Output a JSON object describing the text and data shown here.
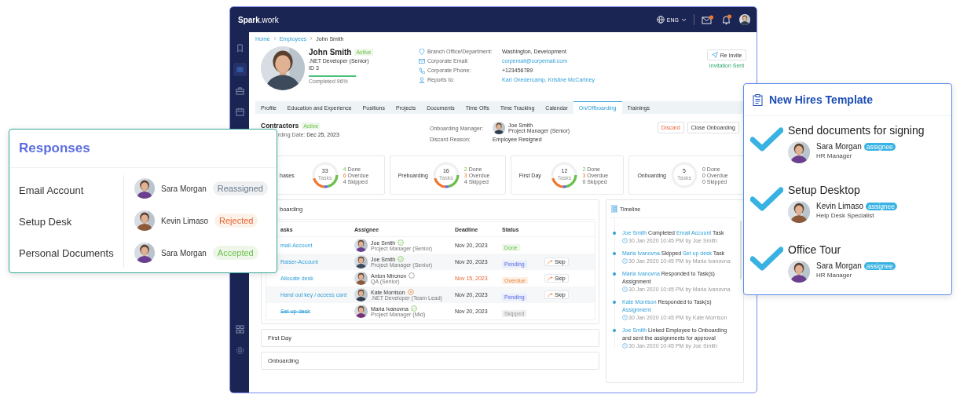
{
  "app": {
    "logo": "**Spark**.work",
    "language": "ENG",
    "sidebar": [
      {
        "kind": "bookmark",
        "selected": false
      },
      {
        "kind": "people",
        "selected": true
      },
      {
        "kind": "briefcase",
        "selected": false
      },
      {
        "kind": "calendar",
        "selected": false
      },
      {
        "kind": "grid",
        "selected": false
      },
      {
        "kind": "gear",
        "selected": false
      }
    ],
    "breadcrumb": [
      {
        "label": "Home",
        "link": true
      },
      {
        "label": "Employees",
        "link": true
      },
      {
        "label": "John Smith",
        "link": false
      }
    ],
    "profile": {
      "name": "John Smith",
      "status": "Active",
      "role": ".NET Developer (Senior)",
      "id": "ID 3",
      "level": 0.96,
      "completion": "Completed 96%",
      "details": [
        {
          "kind": "location",
          "label": "Branch Office/Department:",
          "value": "Washington, Development",
          "link": false
        },
        {
          "kind": "email",
          "label": "Corporate Email:",
          "value": "corpemail@corpemail.com",
          "link": true
        },
        {
          "kind": "phone",
          "label": "Corporate Phone:",
          "value": "+123456789",
          "link": false
        },
        {
          "kind": "person",
          "label": "Reports to:",
          "value": "Karl Onedercamp, Kristine McCartney",
          "link": true
        }
      ],
      "reinvite_button": "Re Invite",
      "invitation_status": "Invitation Sent"
    },
    "tabs": [
      {
        "label": "Profile",
        "selected": false
      },
      {
        "label": "Education and Experience",
        "selected": false
      },
      {
        "label": "Positions",
        "selected": false
      },
      {
        "label": "Projects",
        "selected": false
      },
      {
        "label": "Documents",
        "selected": false
      },
      {
        "label": "Time Offs",
        "selected": false
      },
      {
        "label": "Time Tracking",
        "selected": false
      },
      {
        "label": "Calendar",
        "selected": false
      },
      {
        "label": "On/Offboarding",
        "selected": true
      },
      {
        "label": "Trainings",
        "selected": false
      }
    ],
    "onboarding": {
      "title": "Contractors",
      "status": "Active",
      "date_label": "rding Date:",
      "date": "Dec 25, 2023",
      "manager_label": "Onboarding Manager:",
      "manager_name": "Joe Smith",
      "manager_role": "Project Manager (Senior)",
      "discard_label": "Discard Reason:",
      "discard_reason": "Employee Resigned",
      "discard_button": "Discard",
      "close_button": "Close Onboarding"
    },
    "phases": [
      {
        "name": "hases",
        "kind": "progress",
        "total": "33",
        "unit": "Tasks",
        "done": "4",
        "done_label": "Done",
        "overdue": "6",
        "overdue_label": "Overdue",
        "skipped": "4",
        "skipped_label": "Skipped"
      },
      {
        "name": "Preboarding",
        "kind": "progress",
        "total": "16",
        "unit": "Tasks",
        "done": "2",
        "done_label": "Done",
        "overdue": "3",
        "overdue_label": "Overdue",
        "skipped": "4",
        "skipped_label": "Skipped"
      },
      {
        "name": "First Day",
        "kind": "progress",
        "total": "12",
        "unit": "Tasks",
        "done": "2",
        "done_label": "Done",
        "overdue": "3",
        "overdue_label": "Overdue",
        "skipped": "0",
        "skipped_label": "Skipped"
      },
      {
        "name": "Onboarding",
        "kind": "empty",
        "total": "5",
        "unit": "Tasks",
        "done": "0",
        "done_label": "Done",
        "overdue": "0",
        "overdue_label": "Overdue",
        "skipped": "0",
        "skipped_label": "Skipped"
      }
    ],
    "section": {
      "title": "boarding",
      "columns": [
        "asks",
        "Assignee",
        "Deadline",
        "Status"
      ],
      "rows": [
        {
          "task": "mail-Account",
          "struck": false,
          "assignee": "Joe Smith",
          "role": "Project Manager (Senior)",
          "accepted": true,
          "rejected": false,
          "deadline": "Nov 20, 2023",
          "overdue": false,
          "status": "Done",
          "kind": "done"
        },
        {
          "task": "Raiser-Account",
          "struck": false,
          "assignee": "Joe Smith",
          "role": "Project Manager (Senior)",
          "accepted": true,
          "rejected": false,
          "deadline": "Nov 20, 2023",
          "overdue": false,
          "status": "Pending",
          "kind": "pending",
          "skip": "Skip"
        },
        {
          "task": "Allocate desk",
          "struck": false,
          "assignee": "Anton Mironov",
          "role": "QA (Senior)",
          "accepted": false,
          "rejected": false,
          "deadline": "Nov 15, 2023",
          "overdue": true,
          "status": "Overdue",
          "kind": "overdue",
          "skip": "Skip"
        },
        {
          "task": "Hand out key / access card",
          "struck": false,
          "assignee": "Kate Morrison",
          "role": ".NET Developer (Team Lead)",
          "accepted": false,
          "rejected": true,
          "deadline": "Nov 20, 2023",
          "overdue": false,
          "status": "Pending",
          "kind": "pending",
          "skip": "Skip"
        },
        {
          "task": "Set-up-desk",
          "struck": true,
          "assignee": "Maria Ivanovna",
          "role": "Project Manager (Mid)",
          "accepted": true,
          "rejected": false,
          "deadline": "Nov 20, 2023",
          "overdue": false,
          "status": "Skipped",
          "kind": "skipped"
        }
      ]
    },
    "collapsed_sections": [
      "First Day",
      "Onboarding"
    ],
    "timeline": {
      "title": "Timeline",
      "entries": [
        {
          "parts": [
            {
              "text": "Joe Smith",
              "link": true
            },
            {
              "text": "Completed",
              "link": false
            },
            {
              "text": "Email Account",
              "link": true
            },
            {
              "text": "Task",
              "link": false
            }
          ],
          "meta": "30 Jan 2020 10:45 PM by Joe Smith"
        },
        {
          "parts": [
            {
              "text": "Maria Ivanovna",
              "link": true
            },
            {
              "text": "Skipped",
              "link": false
            },
            {
              "text": "Set up desk",
              "link": true
            },
            {
              "text": "Task",
              "link": false
            }
          ],
          "meta": "30 Jan 2020 10:45 PM by Maria Ivanovna"
        },
        {
          "parts": [
            {
              "text": "Maria Ivanovna",
              "link": true
            },
            {
              "text": "Responded to Task(s) Assignment",
              "link": false
            }
          ],
          "meta": "30 Jan 2020 10:45 PM by Maria Ivanovna"
        },
        {
          "parts": [
            {
              "text": "Kate Morrison",
              "link": true
            },
            {
              "text": "Responded to Task(s)",
              "link": false
            },
            {
              "text": "Assignment",
              "link": true
            }
          ],
          "meta": "30 Jan 2020 10:45 PM by Kate Morrison"
        },
        {
          "parts": [
            {
              "text": "Joe Smith",
              "link": true
            },
            {
              "text": "Linked Employee to Onboarding and sent the assignments for approval",
              "link": false
            }
          ],
          "meta": "30 Jan 2020 10:45 PM by Joe Smith"
        }
      ]
    }
  },
  "responses": {
    "title": "Responses",
    "rows": [
      {
        "task": "Email Account",
        "person": "Sara Morgan",
        "status": "Reassigned",
        "kind": "reassigned"
      },
      {
        "task": "Setup Desk",
        "person": "Kevin Limaso",
        "status": "Rejected",
        "kind": "rejected"
      },
      {
        "task": "Personal Documents",
        "person": "Sara Morgan",
        "status": "Accepted",
        "kind": "accepted"
      }
    ]
  },
  "template": {
    "title": "New Hires Template",
    "items": [
      {
        "title": "Send documents for signing",
        "person": "Sara Morgan",
        "badge": "assignee",
        "role": "HR Manager"
      },
      {
        "title": "Setup Desktop",
        "person": "Kevin Limaso",
        "badge": "assignee",
        "role": "Help Desk Specialist"
      },
      {
        "title": "Office Tour",
        "person": "Sara Morgan",
        "badge": "assignee",
        "role": "HR Manager"
      }
    ]
  }
}
